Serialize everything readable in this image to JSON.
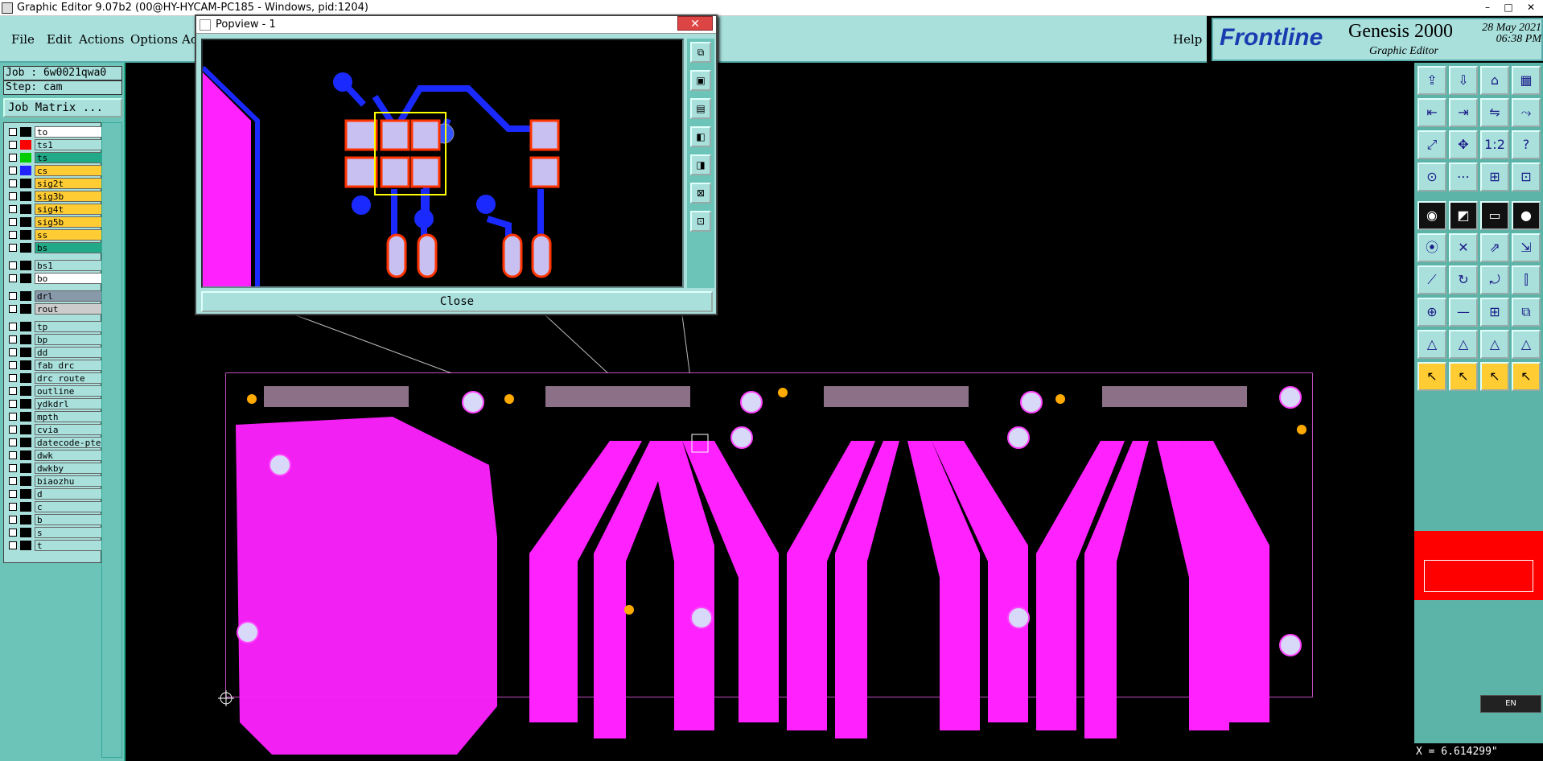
{
  "window": {
    "title": "Graphic Editor 9.07b2 (00@HY-HYCAM-PC185 - Windows, pid:1204)",
    "controls": [
      "–",
      "□",
      "✕"
    ]
  },
  "menu": {
    "items": [
      "File",
      "Edit",
      "Actions",
      "Options",
      "Ac"
    ],
    "help": "Help"
  },
  "logo": {
    "brand": "Frontline",
    "product": "Genesis 2000",
    "subtitle": "Graphic Editor",
    "date": "28 May 2021",
    "time": "06:38 PM"
  },
  "job": {
    "job_label": "Job : 6w0021qwa0",
    "step_label": "Step: cam",
    "matrix_button": "Job Matrix ..."
  },
  "layers": [
    {
      "name": "to",
      "swatch": "#000000",
      "bg": "#ffffff"
    },
    {
      "name": "ts1",
      "swatch": "#ff0000",
      "bg": "#a9e0dc"
    },
    {
      "name": "ts",
      "swatch": "#00cc00",
      "bg": "#22aa88"
    },
    {
      "name": "cs",
      "swatch": "#2222ff",
      "bg": "#ffcc33"
    },
    {
      "name": "sig2t",
      "swatch": "#000000",
      "bg": "#ffcc33"
    },
    {
      "name": "sig3b",
      "swatch": "#000000",
      "bg": "#ffcc33"
    },
    {
      "name": "sig4t",
      "swatch": "#000000",
      "bg": "#ffcc33"
    },
    {
      "name": "sig5b",
      "swatch": "#000000",
      "bg": "#ffcc33"
    },
    {
      "name": "ss",
      "swatch": "#000000",
      "bg": "#ffcc33"
    },
    {
      "name": "bs",
      "swatch": "#000000",
      "bg": "#22aa88"
    },
    {
      "name": "bs1",
      "swatch": "#000000",
      "bg": "#a9e0dc"
    },
    {
      "name": "bo",
      "swatch": "#000000",
      "bg": "#ffffff"
    },
    {
      "name": "drl",
      "swatch": "#000000",
      "bg": "#8899aa"
    },
    {
      "name": "rout",
      "swatch": "#000000",
      "bg": "#cccccc"
    },
    {
      "name": "tp",
      "swatch": "#000000",
      "bg": "#a9e0dc"
    },
    {
      "name": "bp",
      "swatch": "#000000",
      "bg": "#a9e0dc"
    },
    {
      "name": "dd",
      "swatch": "#000000",
      "bg": "#a9e0dc"
    },
    {
      "name": "fab_drc",
      "swatch": "#000000",
      "bg": "#a9e0dc"
    },
    {
      "name": "drc_route",
      "swatch": "#000000",
      "bg": "#a9e0dc"
    },
    {
      "name": "outline",
      "swatch": "#000000",
      "bg": "#a9e0dc"
    },
    {
      "name": "ydkdrl",
      "swatch": "#000000",
      "bg": "#a9e0dc"
    },
    {
      "name": "mpth",
      "swatch": "#000000",
      "bg": "#a9e0dc"
    },
    {
      "name": "cvia",
      "swatch": "#000000",
      "bg": "#a9e0dc"
    },
    {
      "name": "datecode-pte",
      "swatch": "#000000",
      "bg": "#a9e0dc"
    },
    {
      "name": "dwk",
      "swatch": "#000000",
      "bg": "#a9e0dc"
    },
    {
      "name": "dwkby",
      "swatch": "#000000",
      "bg": "#a9e0dc"
    },
    {
      "name": "biaozhu",
      "swatch": "#000000",
      "bg": "#a9e0dc"
    },
    {
      "name": "d",
      "swatch": "#000000",
      "bg": "#a9e0dc"
    },
    {
      "name": "c",
      "swatch": "#000000",
      "bg": "#a9e0dc"
    },
    {
      "name": "b",
      "swatch": "#000000",
      "bg": "#a9e0dc"
    },
    {
      "name": "s",
      "swatch": "#000000",
      "bg": "#a9e0dc"
    },
    {
      "name": "t",
      "swatch": "#000000",
      "bg": "#a9e0dc"
    }
  ],
  "popview": {
    "title": "Popview - 1",
    "close_label": "Close"
  },
  "status": {
    "coords": "X = 6.614299\"",
    "lang": "EN"
  },
  "colors": {
    "copper": "#ff22ff",
    "trace": "#1a2aff",
    "pad_fill": "#c8c0f0",
    "pad_outline": "#ff3300",
    "highlight": "#ffff00"
  },
  "icons": [
    "open-icon",
    "save-icon",
    "home-icon",
    "layout-icon",
    "snap-left-icon",
    "snap-right-icon",
    "flip-icon",
    "route-icon",
    "fit-icon",
    "zoom-icon",
    "scale-icon",
    "help-icon",
    "measure-icon",
    "grid-icon",
    "netlist-icon",
    "drc-icon",
    "select-icon",
    "crop-icon",
    "ruler-icon",
    "circle-icon",
    "connect-icon",
    "delete-icon",
    "move-icon",
    "copy-icon",
    "line-icon",
    "arc-icon",
    "rotate-icon",
    "mirror-icon",
    "pad-icon",
    "minus-icon",
    "array-icon",
    "stretch-icon",
    "triangle-icon",
    "triangle-2-icon",
    "triangle-3-icon",
    "triangle-4-icon",
    "pointer-icon",
    "pointer-2-icon",
    "pointer-3-icon",
    "pointer-4-icon"
  ]
}
